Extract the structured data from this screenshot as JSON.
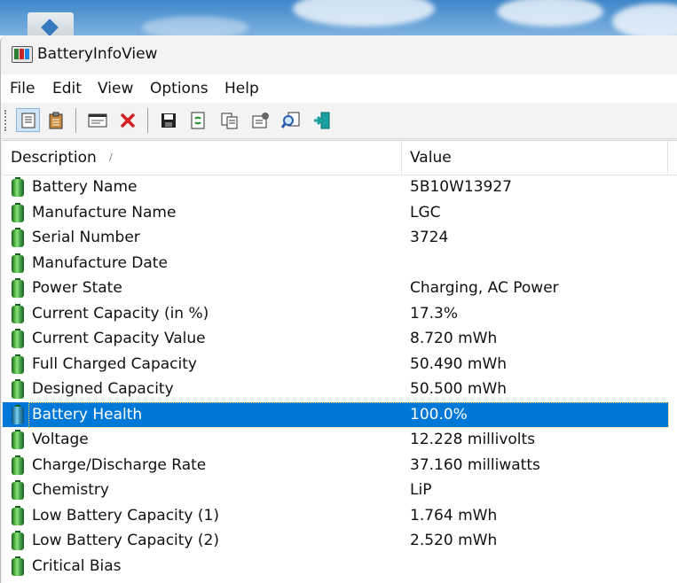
{
  "window": {
    "title": "BatteryInfoView"
  },
  "menu": [
    "File",
    "Edit",
    "View",
    "Options",
    "Help"
  ],
  "toolbar_icons": [
    "properties-icon",
    "clipboard-icon",
    "html-report-icon",
    "delete-icon",
    "save-icon",
    "refresh-icon",
    "copy-icon",
    "options-icon",
    "find-icon",
    "exit-icon"
  ],
  "columns": {
    "description": "Description",
    "value": "Value"
  },
  "rows": [
    {
      "desc": "Battery Name",
      "value": "5B10W13927"
    },
    {
      "desc": "Manufacture Name",
      "value": "LGC"
    },
    {
      "desc": "Serial Number",
      "value": " 3724"
    },
    {
      "desc": "Manufacture Date",
      "value": ""
    },
    {
      "desc": "Power State",
      "value": "Charging, AC Power"
    },
    {
      "desc": "Current Capacity (in %)",
      "value": "17.3%"
    },
    {
      "desc": "Current Capacity Value",
      "value": "8.720 mWh"
    },
    {
      "desc": "Full Charged Capacity",
      "value": "50.490 mWh"
    },
    {
      "desc": "Designed Capacity",
      "value": "50.500 mWh"
    },
    {
      "desc": "Battery Health",
      "value": "100.0%"
    },
    {
      "desc": "Voltage",
      "value": "12.228 millivolts"
    },
    {
      "desc": "Charge/Discharge Rate",
      "value": "37.160 milliwatts"
    },
    {
      "desc": "Chemistry",
      "value": "LiP"
    },
    {
      "desc": "Low Battery Capacity (1)",
      "value": "1.764 mWh"
    },
    {
      "desc": "Low Battery Capacity (2)",
      "value": "2.520 mWh"
    },
    {
      "desc": "Critical Bias",
      "value": ""
    }
  ],
  "selected_row": "Battery Health",
  "colors": {
    "selection": "#0078d7",
    "battery_green": "#4caf50"
  }
}
